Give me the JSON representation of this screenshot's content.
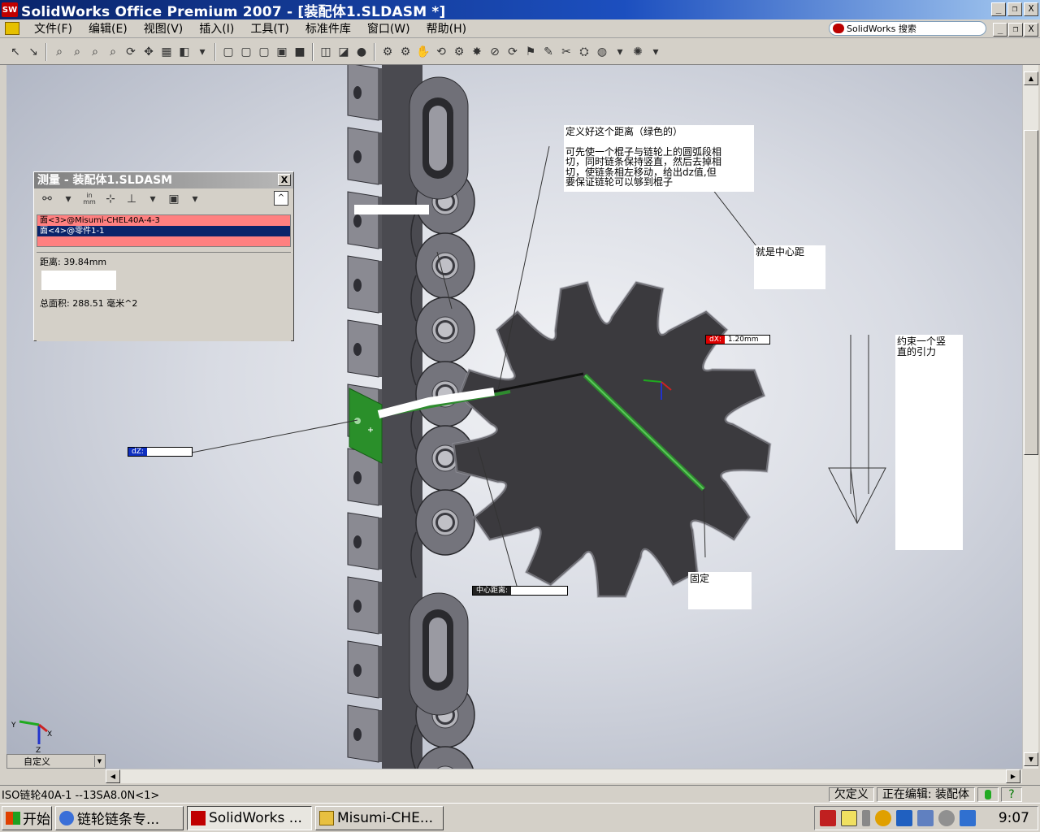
{
  "window": {
    "title": "SolidWorks Office Premium 2007 - [装配体1.SLDASM *]",
    "app_badge": "SW",
    "controls": {
      "minimize": "_",
      "restore": "❐",
      "close": "X"
    }
  },
  "menu": {
    "items": [
      "文件(F)",
      "编辑(E)",
      "视图(V)",
      "插入(I)",
      "工具(T)",
      "标准件库",
      "窗口(W)",
      "帮助(H)"
    ],
    "search_label": "SolidWorks 搜索"
  },
  "measure_panel": {
    "title": "测量 - 装配体1.SLDASM",
    "close": "X",
    "units_button": "in mm",
    "collapse": "^",
    "selections": [
      "面<3>@Misumi-CHEL40A-4-3",
      "面<4>@零件1-1"
    ],
    "distance": "距离: 39.84mm",
    "total_area": "总面积: 288.51 毫米^2"
  },
  "annotations": {
    "define_distance": [
      "定义好这个距离（绿色的）",
      "",
      "可先使一个棍子与链轮上的圆弧段相",
      "切，同时链条保持竖直，然后去掉相",
      "切，使链条相左移动，给出dz值,但",
      "要保证链轮可以够到棍子"
    ],
    "center_distance_note": "就是中心距",
    "gravity_note": [
      "约束一个竖",
      "直的引力"
    ],
    "fixed_note": "固定"
  },
  "dims": {
    "dx_label": "dX:",
    "dx_value": "1.20mm",
    "dz_label": "dZ:",
    "center_label": "中心距离:"
  },
  "view": {
    "orientation": "自定义"
  },
  "statusbar": {
    "component": "ISO链轮40A-1 --13SA8.0N<1>",
    "state": "欠定义",
    "editing": "正在编辑: 装配体",
    "help": "?"
  },
  "taskbar": {
    "start": "开始",
    "tasks": [
      "链轮链条专...",
      "SolidWorks ...",
      "Misumi-CHE..."
    ],
    "clock": "9:07"
  },
  "colors": {
    "title_active": "#0a246a",
    "gear": "#3b3a3e",
    "chain_link": "#7a7a80",
    "green_line": "#2e8b2e",
    "selection_bg": "#ff8080"
  }
}
